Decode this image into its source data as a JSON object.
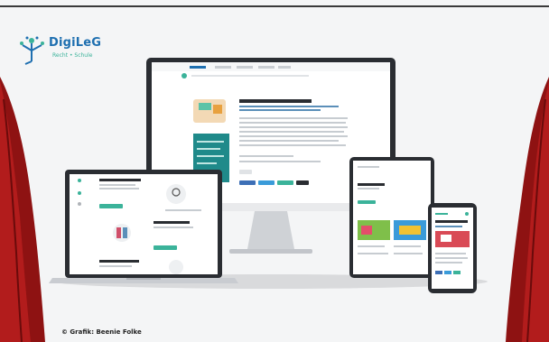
{
  "logo": {
    "title": "DigiLeG",
    "subtitle": "Recht • Schule",
    "icon": "tree-figure-icon"
  },
  "caption": "© Grafik: Beenie Folke",
  "colors": {
    "curtain": "#9b1414",
    "brand_blue": "#1e6fb0",
    "brand_teal": "#3bb39a",
    "device_frame": "#2a2d32"
  }
}
